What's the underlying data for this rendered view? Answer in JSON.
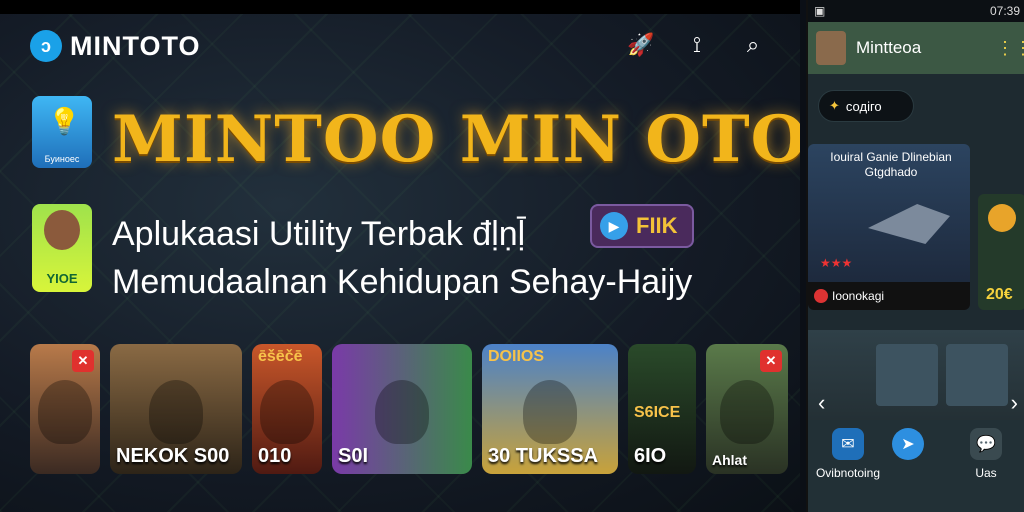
{
  "banner": {
    "brand": "MINTOTO",
    "headline": "MINTOO MIN OTO",
    "subtitle_line1": "Aplukaasi Utility Terbak đḷṇḹ",
    "subtitle_line2": "Memudaalnan Kehidupan Sehay-Haijy",
    "play_label": "FIIK",
    "app_icon1_label": "Буиноес",
    "app_icon2_label": "YIOE"
  },
  "games": [
    {
      "label": "",
      "badge": "✕"
    },
    {
      "label": "NEKOK S00",
      "badge": ""
    },
    {
      "label": "010",
      "top": "ēšēčē",
      "badge": ""
    },
    {
      "label": "S0I",
      "badge": ""
    },
    {
      "label": "30 TUKSSA",
      "top": "DOIIOS",
      "badge": ""
    },
    {
      "label": "6IO",
      "top": "S6ICE",
      "badge": ""
    },
    {
      "label": "Ahlat",
      "badge": "✕"
    }
  ],
  "phone": {
    "status_time": "07:39",
    "app_title": "Mintteoa",
    "chip_label": "содіго",
    "feature_title": "Iouiral Ganie Dlinebian Gtgdhado",
    "feature_footer": "Ioonokagi",
    "side_card_value": "20€",
    "nav": [
      {
        "label": "Ovibnotoing",
        "icon": "mail-icon"
      },
      {
        "label": "",
        "icon": "send-icon"
      },
      {
        "label": "Uas",
        "icon": "chat-icon"
      }
    ]
  },
  "colors": {
    "gold": "#f2b51b",
    "header_green": "#3c5844",
    "accent_blue": "#1aa1e8"
  }
}
